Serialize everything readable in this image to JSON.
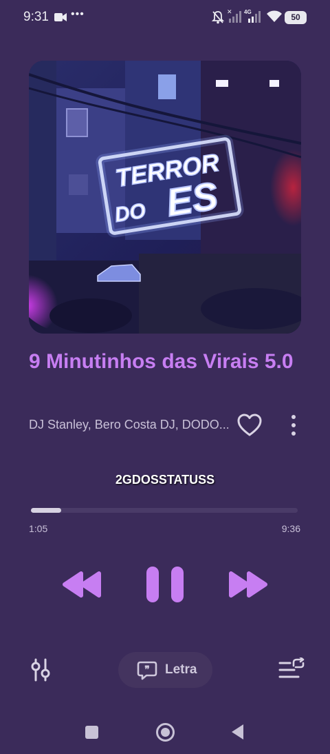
{
  "status_bar": {
    "time": "9:31",
    "camera_icon": "video-camera-icon",
    "battery": "50",
    "network": "4G"
  },
  "player": {
    "album_art_text_line1": "TERROR",
    "album_art_text_line2": "DO",
    "album_art_text_line3": "ES",
    "title": "9 Minutinhos das Virais 5.0",
    "artist": "DJ Stanley, Bero Costa DJ, DODO....",
    "watermark": "2GDOSSTATUSS",
    "progress": {
      "elapsed": "1:05",
      "total": "9:36",
      "fraction": 0.113
    },
    "lyrics_label": "Letra"
  },
  "colors": {
    "background": "#3b2b5a",
    "accent": "#c77ef2",
    "muted_text": "#c9c1d8"
  }
}
